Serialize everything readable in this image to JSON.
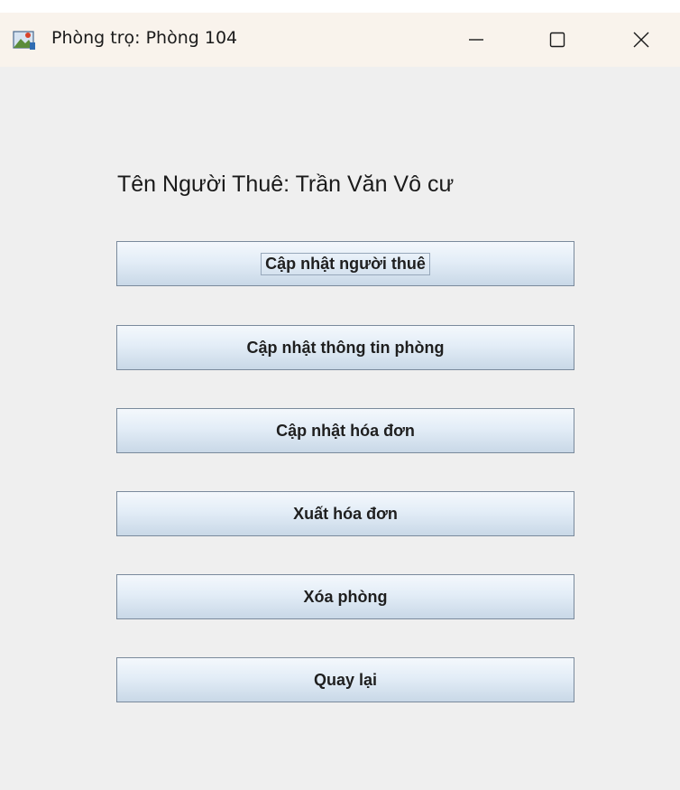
{
  "window": {
    "title": "Phòng trọ: Phòng 104",
    "controls": {
      "minimize_icon": "minimize-icon",
      "maximize_icon": "maximize-icon",
      "close_icon": "close-icon"
    }
  },
  "main": {
    "tenant_heading": "Tên Người Thuê: Trần Văn Vô cư",
    "buttons": [
      {
        "label": "Cập nhật người thuê",
        "focused": true
      },
      {
        "label": "Cập nhật thông tin phòng",
        "focused": false
      },
      {
        "label": "Cập nhật hóa đơn",
        "focused": false
      },
      {
        "label": "Xuất hóa đơn",
        "focused": false
      },
      {
        "label": "Xóa phòng",
        "focused": false
      },
      {
        "label": "Quay lại",
        "focused": false
      }
    ]
  },
  "colors": {
    "titlebar_bg": "#f9f3ec",
    "window_bg": "#efefef",
    "button_border": "#7a8a9c"
  }
}
